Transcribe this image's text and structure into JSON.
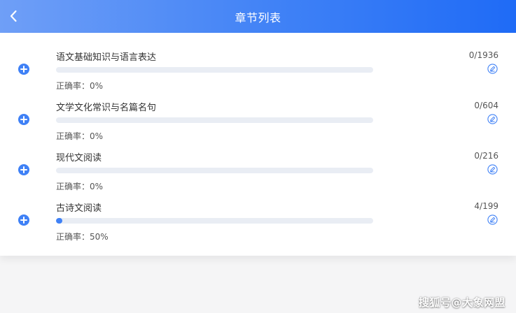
{
  "header": {
    "title": "章节列表",
    "back_icon": "chevron-left-icon",
    "gradient_colors": [
      "#6f9ff7",
      "#1f6bf6"
    ]
  },
  "chapters": [
    {
      "name": "语文基础知识与语言表达",
      "count": "0/1936",
      "accuracy_label": "正确率：",
      "accuracy_value": "0%",
      "progress_fraction": 0.0,
      "add_icon": "plus-circle-icon",
      "edit_icon": "pencil-circle-icon"
    },
    {
      "name": "文学文化常识与名篇名句",
      "count": "0/604",
      "accuracy_label": "正确率：",
      "accuracy_value": "0%",
      "progress_fraction": 0.0,
      "add_icon": "plus-circle-icon",
      "edit_icon": "pencil-circle-icon"
    },
    {
      "name": "现代文阅读",
      "count": "0/216",
      "accuracy_label": "正确率：",
      "accuracy_value": "0%",
      "progress_fraction": 0.0,
      "add_icon": "plus-circle-icon",
      "edit_icon": "pencil-circle-icon"
    },
    {
      "name": "古诗文阅读",
      "count": "4/199",
      "accuracy_label": "正确率：",
      "accuracy_value": "50%",
      "progress_fraction": 0.02,
      "add_icon": "plus-circle-icon",
      "edit_icon": "pencil-circle-icon"
    }
  ],
  "colors": {
    "accent": "#3f81f6",
    "track": "#e9edf4",
    "page_bg": "#f5f5f6"
  },
  "watermark": {
    "text": "搜狐号@大象网盟"
  }
}
